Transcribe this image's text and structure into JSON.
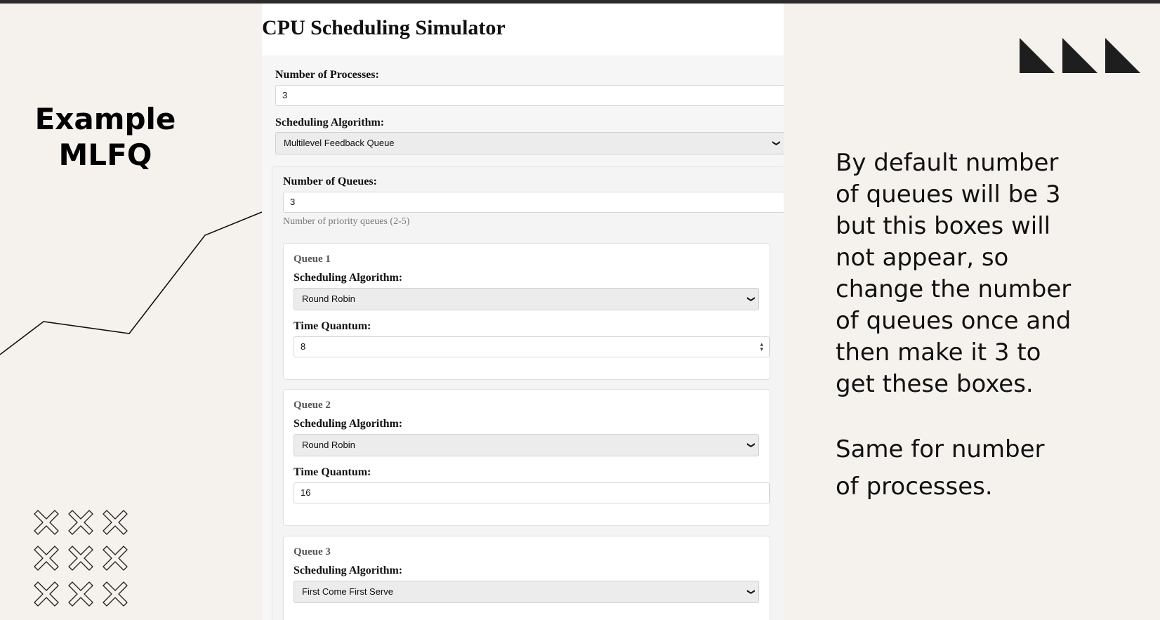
{
  "slide": {
    "title_line1": "Example",
    "title_line2": "MLFQ",
    "note_main": "By default number\nof  queues will be 3\nbut  this boxes will\nnot  appear, so\nchange the  number\nof queues  once and\nthen make  it 3 to\nget these  boxes.",
    "note_second": "Same for number\nof  processes.",
    "text_color": "#111111",
    "background": "#f5f2ee"
  },
  "app": {
    "title": "CPU Scheduling Simulator",
    "num_processes_label": "Number of Processes:",
    "num_processes_value": "3",
    "algorithm_label": "Scheduling Algorithm:",
    "algorithm_value": "Multilevel Feedback Queue",
    "num_queues_label": "Number of Queues:",
    "num_queues_value": "3",
    "num_queues_hint": "Number of priority queues (2-5)",
    "queues": [
      {
        "title": "Queue 1",
        "algorithm_label": "Scheduling Algorithm:",
        "algorithm_value": "Round Robin",
        "quantum_label": "Time Quantum:",
        "quantum_value": "8"
      },
      {
        "title": "Queue 2",
        "algorithm_label": "Scheduling Algorithm:",
        "algorithm_value": "Round Robin",
        "quantum_label": "Time Quantum:",
        "quantum_value": "16"
      },
      {
        "title": "Queue 3",
        "algorithm_label": "Scheduling Algorithm:",
        "algorithm_value": "First Come First Serve"
      }
    ]
  },
  "icons": {
    "select_arrow": "chevron-down-icon",
    "number_spinner": "spinner-icon"
  }
}
